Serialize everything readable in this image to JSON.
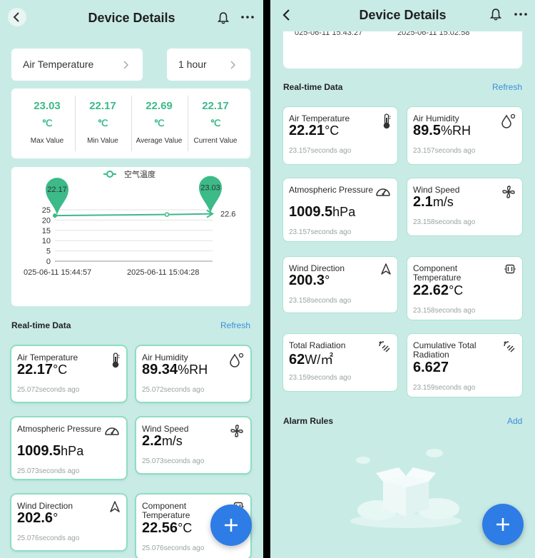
{
  "header": {
    "title": "Device Details"
  },
  "left": {
    "selectors": {
      "metric": "Air Temperature",
      "range": "1 hour"
    },
    "stats": [
      {
        "value": "23.03",
        "unit": "℃",
        "label": "Max Value"
      },
      {
        "value": "22.17",
        "unit": "℃",
        "label": "Min Value"
      },
      {
        "value": "22.69",
        "unit": "℃",
        "label": "Average Value"
      },
      {
        "value": "22.17",
        "unit": "℃",
        "label": "Current Value"
      }
    ],
    "realtime_title": "Real-time Data",
    "refresh": "Refresh",
    "cards": [
      {
        "label": "Air Temperature",
        "value": "22.17",
        "unit": "°C",
        "ago": "25.072seconds ago",
        "icon": "thermometer-icon"
      },
      {
        "label": "Air Humidity",
        "value": "89.34",
        "unit": "%RH",
        "ago": "25.072seconds ago",
        "icon": "humidity-drop-icon"
      },
      {
        "label": "Atmospheric Pressure",
        "value": "1009.5",
        "unit": "hPa",
        "ago": "25.073seconds ago",
        "icon": "gauge-icon"
      },
      {
        "label": "Wind Speed",
        "value": "2.2",
        "unit": "m/s",
        "ago": "25.073seconds ago",
        "icon": "fan-icon"
      },
      {
        "label": "Wind Direction",
        "value": "202.6",
        "unit": "°",
        "ago": "25.076seconds ago",
        "icon": "arrow-direction-icon"
      },
      {
        "label": "Component Temperature",
        "value": "22.56",
        "unit": "°C",
        "ago": "25.076seconds ago",
        "icon": "component-icon"
      }
    ]
  },
  "chart_data": {
    "type": "line",
    "legend": "空气温度",
    "x": [
      "2025-06-11 15:44:57",
      "2025-06-11 15:04:28",
      ""
    ],
    "x_tick_labels": [
      "025-06-11 15:44:57",
      "2025-06-11 15:04:28"
    ],
    "series": [
      {
        "name": "空气温度",
        "values": [
          22.17,
          22.69,
          23.03
        ]
      }
    ],
    "y_ticks": [
      0,
      5,
      10,
      15,
      20,
      25
    ],
    "ylim": [
      0,
      25
    ],
    "annotations": {
      "min_label": "22.17",
      "max_label": "23.03",
      "end_label": "22.6"
    },
    "grid": true,
    "colors": {
      "line": "#3cba88"
    }
  },
  "right": {
    "timestamps": [
      "025-06-11 15:43:27",
      "2025-06-11 15:02:58"
    ],
    "realtime_title": "Real-time Data",
    "refresh": "Refresh",
    "cards": [
      {
        "label": "Air Temperature",
        "value": "22.21",
        "unit": "°C",
        "ago": "23.157seconds ago",
        "icon": "thermometer-icon"
      },
      {
        "label": "Air Humidity",
        "value": "89.5",
        "unit": "%RH",
        "ago": "23.157seconds ago",
        "icon": "humidity-drop-icon"
      },
      {
        "label": "Atmospheric Pressure",
        "value": "1009.5",
        "unit": "hPa",
        "ago": "23.157seconds ago",
        "icon": "gauge-icon"
      },
      {
        "label": "Wind Speed",
        "value": "2.1",
        "unit": "m/s",
        "ago": "23.158seconds ago",
        "icon": "fan-icon"
      },
      {
        "label": "Wind Direction",
        "value": "200.3",
        "unit": "°",
        "ago": "23.158seconds ago",
        "icon": "arrow-direction-icon"
      },
      {
        "label": "Component Temperature",
        "value": "22.62",
        "unit": "°C",
        "ago": "23.158seconds ago",
        "icon": "component-icon"
      },
      {
        "label": "Total Radiation",
        "value": "62",
        "unit": "W/㎡",
        "ago": "23.159seconds ago",
        "icon": "radiation-icon"
      },
      {
        "label": "Cumulative Total Radiation",
        "value": "6.627",
        "unit": "",
        "ago": "23.159seconds ago",
        "icon": "radiation-icon"
      }
    ],
    "alarm_title": "Alarm Rules",
    "add": "Add"
  },
  "colors": {
    "background": "#c9ebe6",
    "accent": "#3cba88",
    "link": "#3a8fd6",
    "fab": "#2e7de6"
  }
}
